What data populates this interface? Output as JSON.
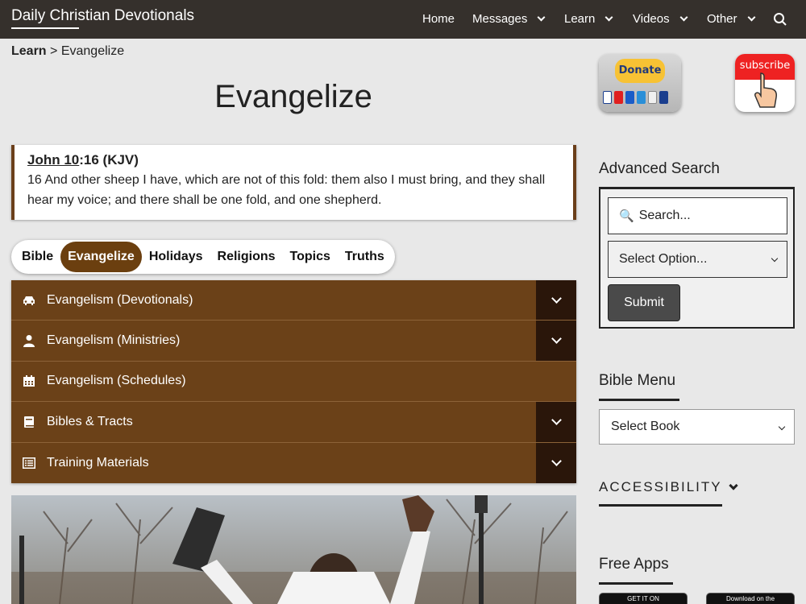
{
  "header": {
    "site_title": "Daily Christian Devotionals",
    "nav": [
      {
        "label": "Home",
        "has_dropdown": false
      },
      {
        "label": "Messages",
        "has_dropdown": true
      },
      {
        "label": "Learn",
        "has_dropdown": true
      },
      {
        "label": "Videos",
        "has_dropdown": true
      },
      {
        "label": "Other",
        "has_dropdown": true
      }
    ],
    "search_icon": "search-icon"
  },
  "breadcrumb": {
    "parent": "Learn",
    "separator": ">",
    "current": "Evangelize"
  },
  "page_title": "Evangelize",
  "verse": {
    "book": "John 10",
    "ref_rest": ":16 (KJV)",
    "text": "16 And other sheep I have, which are not of this fold: them also I must bring, and they shall hear my voice; and there shall be one fold, and one shepherd."
  },
  "tabs": [
    {
      "label": "Bible",
      "active": false
    },
    {
      "label": "Evangelize",
      "active": true
    },
    {
      "label": "Holidays",
      "active": false
    },
    {
      "label": "Religions",
      "active": false
    },
    {
      "label": "Topics",
      "active": false
    },
    {
      "label": "Truths",
      "active": false
    }
  ],
  "accordion": [
    {
      "label": "Evangelism (Devotionals)",
      "icon": "car-icon",
      "expandable": true
    },
    {
      "label": "Evangelism (Ministries)",
      "icon": "person-icon",
      "expandable": true
    },
    {
      "label": "Evangelism (Schedules)",
      "icon": "calendar-icon",
      "expandable": false
    },
    {
      "label": "Bibles & Tracts",
      "icon": "book-icon",
      "expandable": true
    },
    {
      "label": "Training Materials",
      "icon": "list-icon",
      "expandable": true
    }
  ],
  "sidebar": {
    "donate_label": "Donate",
    "subscribe_label": "subscribe",
    "advanced_search": {
      "heading": "Advanced Search",
      "search_placeholder": "Search...",
      "select_value": "Select Option...",
      "submit_label": "Submit"
    },
    "bible_menu": {
      "heading": "Bible Menu",
      "select_value": "Select Book"
    },
    "accessibility_label": "ACCESSIBILITY",
    "free_apps": {
      "heading": "Free Apps",
      "badges": [
        "GET IT ON",
        "Download on the"
      ]
    }
  },
  "colors": {
    "nav_bg": "#35302c",
    "accent_brown": "#6b4118",
    "toggle_dark": "#2a160a"
  }
}
